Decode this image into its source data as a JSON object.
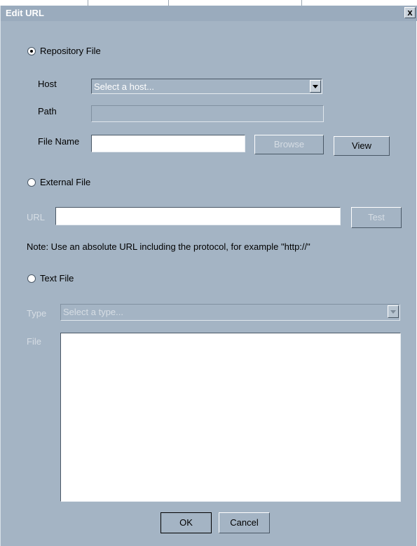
{
  "window": {
    "title": "Edit URL",
    "close_glyph": "x"
  },
  "repository": {
    "radio_label": "Repository File",
    "selected": true,
    "host_label": "Host",
    "host_select_value": "Select a host...",
    "path_label": "Path",
    "path_value": "",
    "file_name_label": "File Name",
    "file_name_value": "",
    "browse_label": "Browse",
    "view_label": "View"
  },
  "external": {
    "radio_label": "External File",
    "selected": false,
    "url_label": "URL",
    "url_value": "",
    "test_label": "Test",
    "note": "Note: Use an absolute URL including the protocol, for example \"http://\""
  },
  "text_file": {
    "radio_label": "Text File",
    "selected": false,
    "type_label": "Type",
    "type_select_value": "Select a type...",
    "file_label": "File",
    "file_content": ""
  },
  "footer": {
    "ok_label": "OK",
    "cancel_label": "Cancel"
  }
}
